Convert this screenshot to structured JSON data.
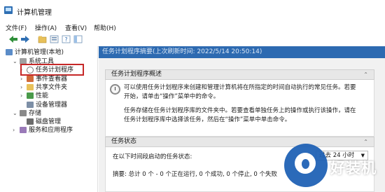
{
  "window": {
    "title": "计算机管理"
  },
  "menu": [
    "文件(F)",
    "操作(A)",
    "查看(V)",
    "帮助(H)"
  ],
  "toolbar": {
    "icons": [
      "back-arrow-icon",
      "forward-arrow-icon",
      "folder-up-icon",
      "properties-icon",
      "help-icon",
      "show-hide-icon"
    ]
  },
  "tree": {
    "root": "计算机管理(本地)",
    "system_tools": "系统工具",
    "task_scheduler": "任务计划程序",
    "event_viewer": "事件查看器",
    "shared_folders": "共享文件夹",
    "performance": "性能",
    "device_manager": "设备管理器",
    "storage": "存储",
    "disk_management": "磁盘管理",
    "services": "服务和应用程序"
  },
  "main": {
    "header": "任务计划程序摘要(上次刷新时间: 2022/5/14 20:50:14)",
    "overview_title": "任务计划程序概述",
    "overview_p1_line1": "可以使用任务计划程序来创建和管理计算机将在所指定的时间自动执行的常见任务。若要",
    "overview_p1_line2": "开始，请单击“操作”菜单中的命令。",
    "overview_p2_line1": "任务存储在任务计划程序库的文件夹中。若要查看单独任务上的操作或执行该操作，请在",
    "overview_p2_line2": "任务计划程序库中选择该任务，然后在“操作”菜单中单击命令。",
    "status_title": "任务状态",
    "status_label": "在以下时间段启动的任务状态:",
    "status_select": "过去 24 小时",
    "summary": "摘要: 总计 0 个 - 0 个正在运行, 0 个成功, 0 个停止, 0 个失败"
  },
  "watermark": {
    "text": "好装机"
  },
  "colors": {
    "header_bg": "#2d6ab1",
    "highlight_border": "#c62828",
    "watermark": "#1c5fb4"
  }
}
